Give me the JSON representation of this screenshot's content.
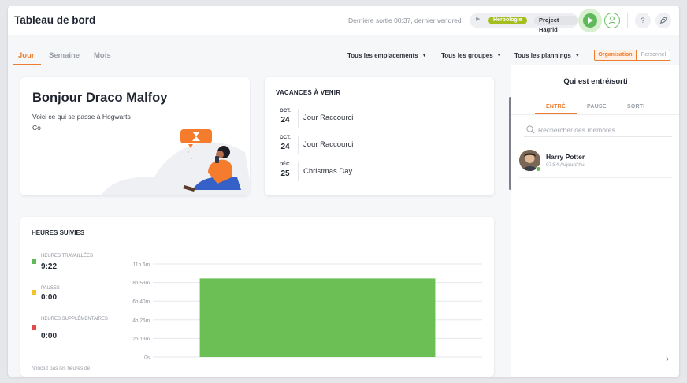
{
  "header": {
    "title": "Tableau de bord",
    "last_exit": "Dernière sortie 00:37, dernier vendredi",
    "activity_tag": "Herbologie",
    "project_tag": "Project Hagrid",
    "help_label": "?"
  },
  "tabs": [
    {
      "label": "Jour",
      "active": true
    },
    {
      "label": "Semaine",
      "active": false
    },
    {
      "label": "Mois",
      "active": false
    }
  ],
  "filters": {
    "locations": "Tous les emplacements",
    "groups": "Tous les groupes",
    "schedules": "Tous les plannings"
  },
  "view_toggle": {
    "organisation": "Organisation",
    "personal": "Personnel",
    "selected": "Organisation"
  },
  "welcome": {
    "greeting": "Bonjour Draco Malfoy",
    "subtitle": "Voici ce qui se passe à Hogwarts Co"
  },
  "holidays": {
    "title": "VACANCES À VENIR",
    "items": [
      {
        "month": "OCT.",
        "day": "24",
        "name": "Jour Raccourci"
      },
      {
        "month": "OCT.",
        "day": "24",
        "name": "Jour Raccourci"
      },
      {
        "month": "DÉC.",
        "day": "25",
        "name": "Christmas Day"
      }
    ]
  },
  "tracked": {
    "title": "HEURES SUIVIES",
    "legend": [
      {
        "label": "HEURES TRAVAILLÉES",
        "value": "9:22",
        "color": "#5fb85a"
      },
      {
        "label": "PAUSES",
        "value": "0:00",
        "color": "#f5c22b"
      },
      {
        "label": "HEURES SUPPLÉMENTAIRES",
        "value": "0:00",
        "color": "#e5484d"
      }
    ],
    "note": "N'inclut pas les heures de"
  },
  "chart_data": {
    "type": "bar",
    "categories": [
      ""
    ],
    "series": [
      {
        "values": [
          9.37
        ],
        "color": "#6bbf55"
      }
    ],
    "yticks": [
      "0s",
      "2h 13m",
      "4h 26m",
      "6h 40m",
      "8h 53m",
      "11h 6m"
    ],
    "ylim": [
      0,
      11.1
    ],
    "grid": true,
    "xlabel": "",
    "ylabel": ""
  },
  "panel": {
    "title": "Qui est entré/sorti",
    "tabs": [
      {
        "label": "ENTRÉ",
        "active": true
      },
      {
        "label": "PAUSE",
        "active": false
      },
      {
        "label": "SORTI",
        "active": false
      }
    ],
    "search_placeholder": "Rechercher des membres...",
    "members": [
      {
        "name": "Harry Potter",
        "time": "07:54 Aujourd'hui"
      }
    ]
  },
  "colors": {
    "accent": "#ee7c2e",
    "success": "#5fb85a"
  }
}
